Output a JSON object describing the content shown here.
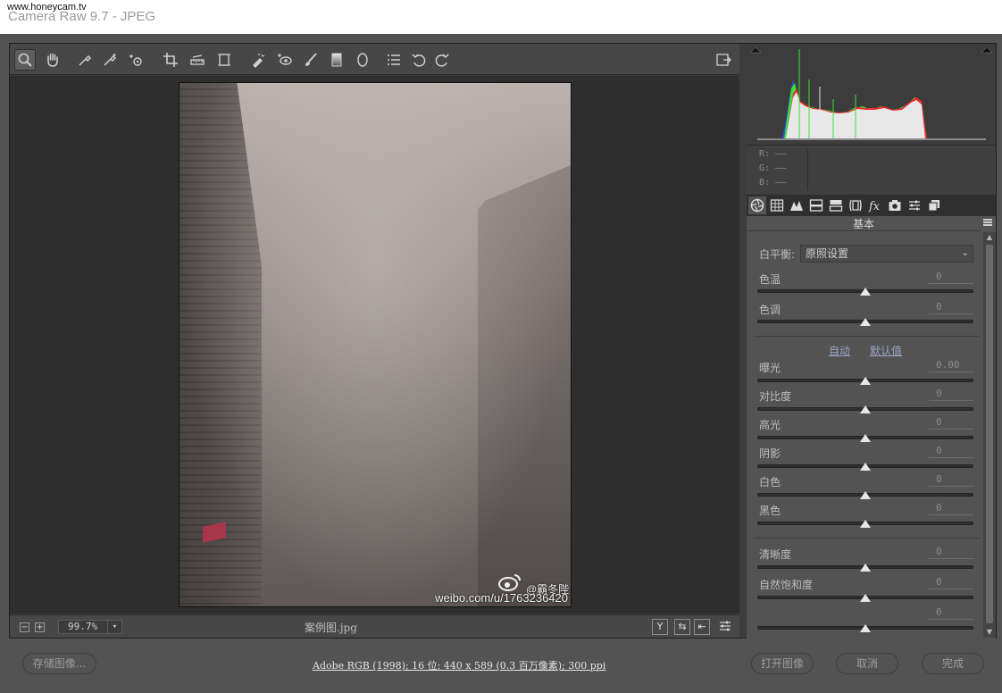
{
  "window": {
    "title": "Camera Raw 9.7 -  JPEG",
    "watermark": "www.honeycam.tv"
  },
  "toolbar": {
    "tools": [
      "zoom-icon",
      "hand-icon",
      "white-balance-icon",
      "color-sampler-icon",
      "targeted-adjustment-icon",
      "crop-icon",
      "straighten-icon",
      "transform-icon",
      "spot-removal-icon",
      "red-eye-icon",
      "adjustment-brush-icon",
      "graduated-filter-icon",
      "radial-filter-icon",
      "preferences-icon",
      "rotate-ccw-icon",
      "rotate-cw-icon"
    ],
    "fullscreen_icon": "fullscreen-icon"
  },
  "preview": {
    "watermark_handle": "@霸冬陛",
    "watermark_url": "weibo.com/u/1763236420"
  },
  "statusbar": {
    "zoom_minus": "−",
    "zoom_plus": "+",
    "zoom_value": "99.7%",
    "filename": "案例图.jpg",
    "toggle_y": "Y",
    "toggle_compare": "⇆",
    "toggle_swap": "⇤"
  },
  "rgb_readout": {
    "r": "R: ——",
    "g": "G: ——",
    "b": "B: ——"
  },
  "panel": {
    "title": "基本",
    "white_balance_label": "白平衡:",
    "white_balance_value": "原照设置",
    "auto_label": "自动",
    "default_label": "默认值",
    "sliders": [
      {
        "label": "色温",
        "value": "0",
        "level": 0.5
      },
      {
        "label": "色调",
        "value": "0",
        "level": 0.5
      },
      {
        "label": "曝光",
        "value": "0.00",
        "level": 0.5
      },
      {
        "label": "对比度",
        "value": "0",
        "level": 0.5
      },
      {
        "label": "高光",
        "value": "0",
        "level": 0.5
      },
      {
        "label": "阴影",
        "value": "0",
        "level": 0.5
      },
      {
        "label": "白色",
        "value": "0",
        "level": 0.5
      },
      {
        "label": "黑色",
        "value": "0",
        "level": 0.5
      },
      {
        "label": "清晰度",
        "value": "0",
        "level": 0.5
      },
      {
        "label": "自然饱和度",
        "value": "0",
        "level": 0.5
      },
      {
        "label": "",
        "value": "0",
        "level": 0.5
      }
    ]
  },
  "bottom": {
    "save_label": "存储图像...",
    "info": "Adobe RGB (1998); 16 位; 440 x 589 (0.3 百万像素); 300 ppi",
    "open_label": "打开图像",
    "cancel_label": "取消",
    "done_label": "完成"
  },
  "colors": {
    "background": "#535353",
    "toolbar": "#474747",
    "preview_bg": "#2e2e2e",
    "link": "#9aa6c2"
  }
}
